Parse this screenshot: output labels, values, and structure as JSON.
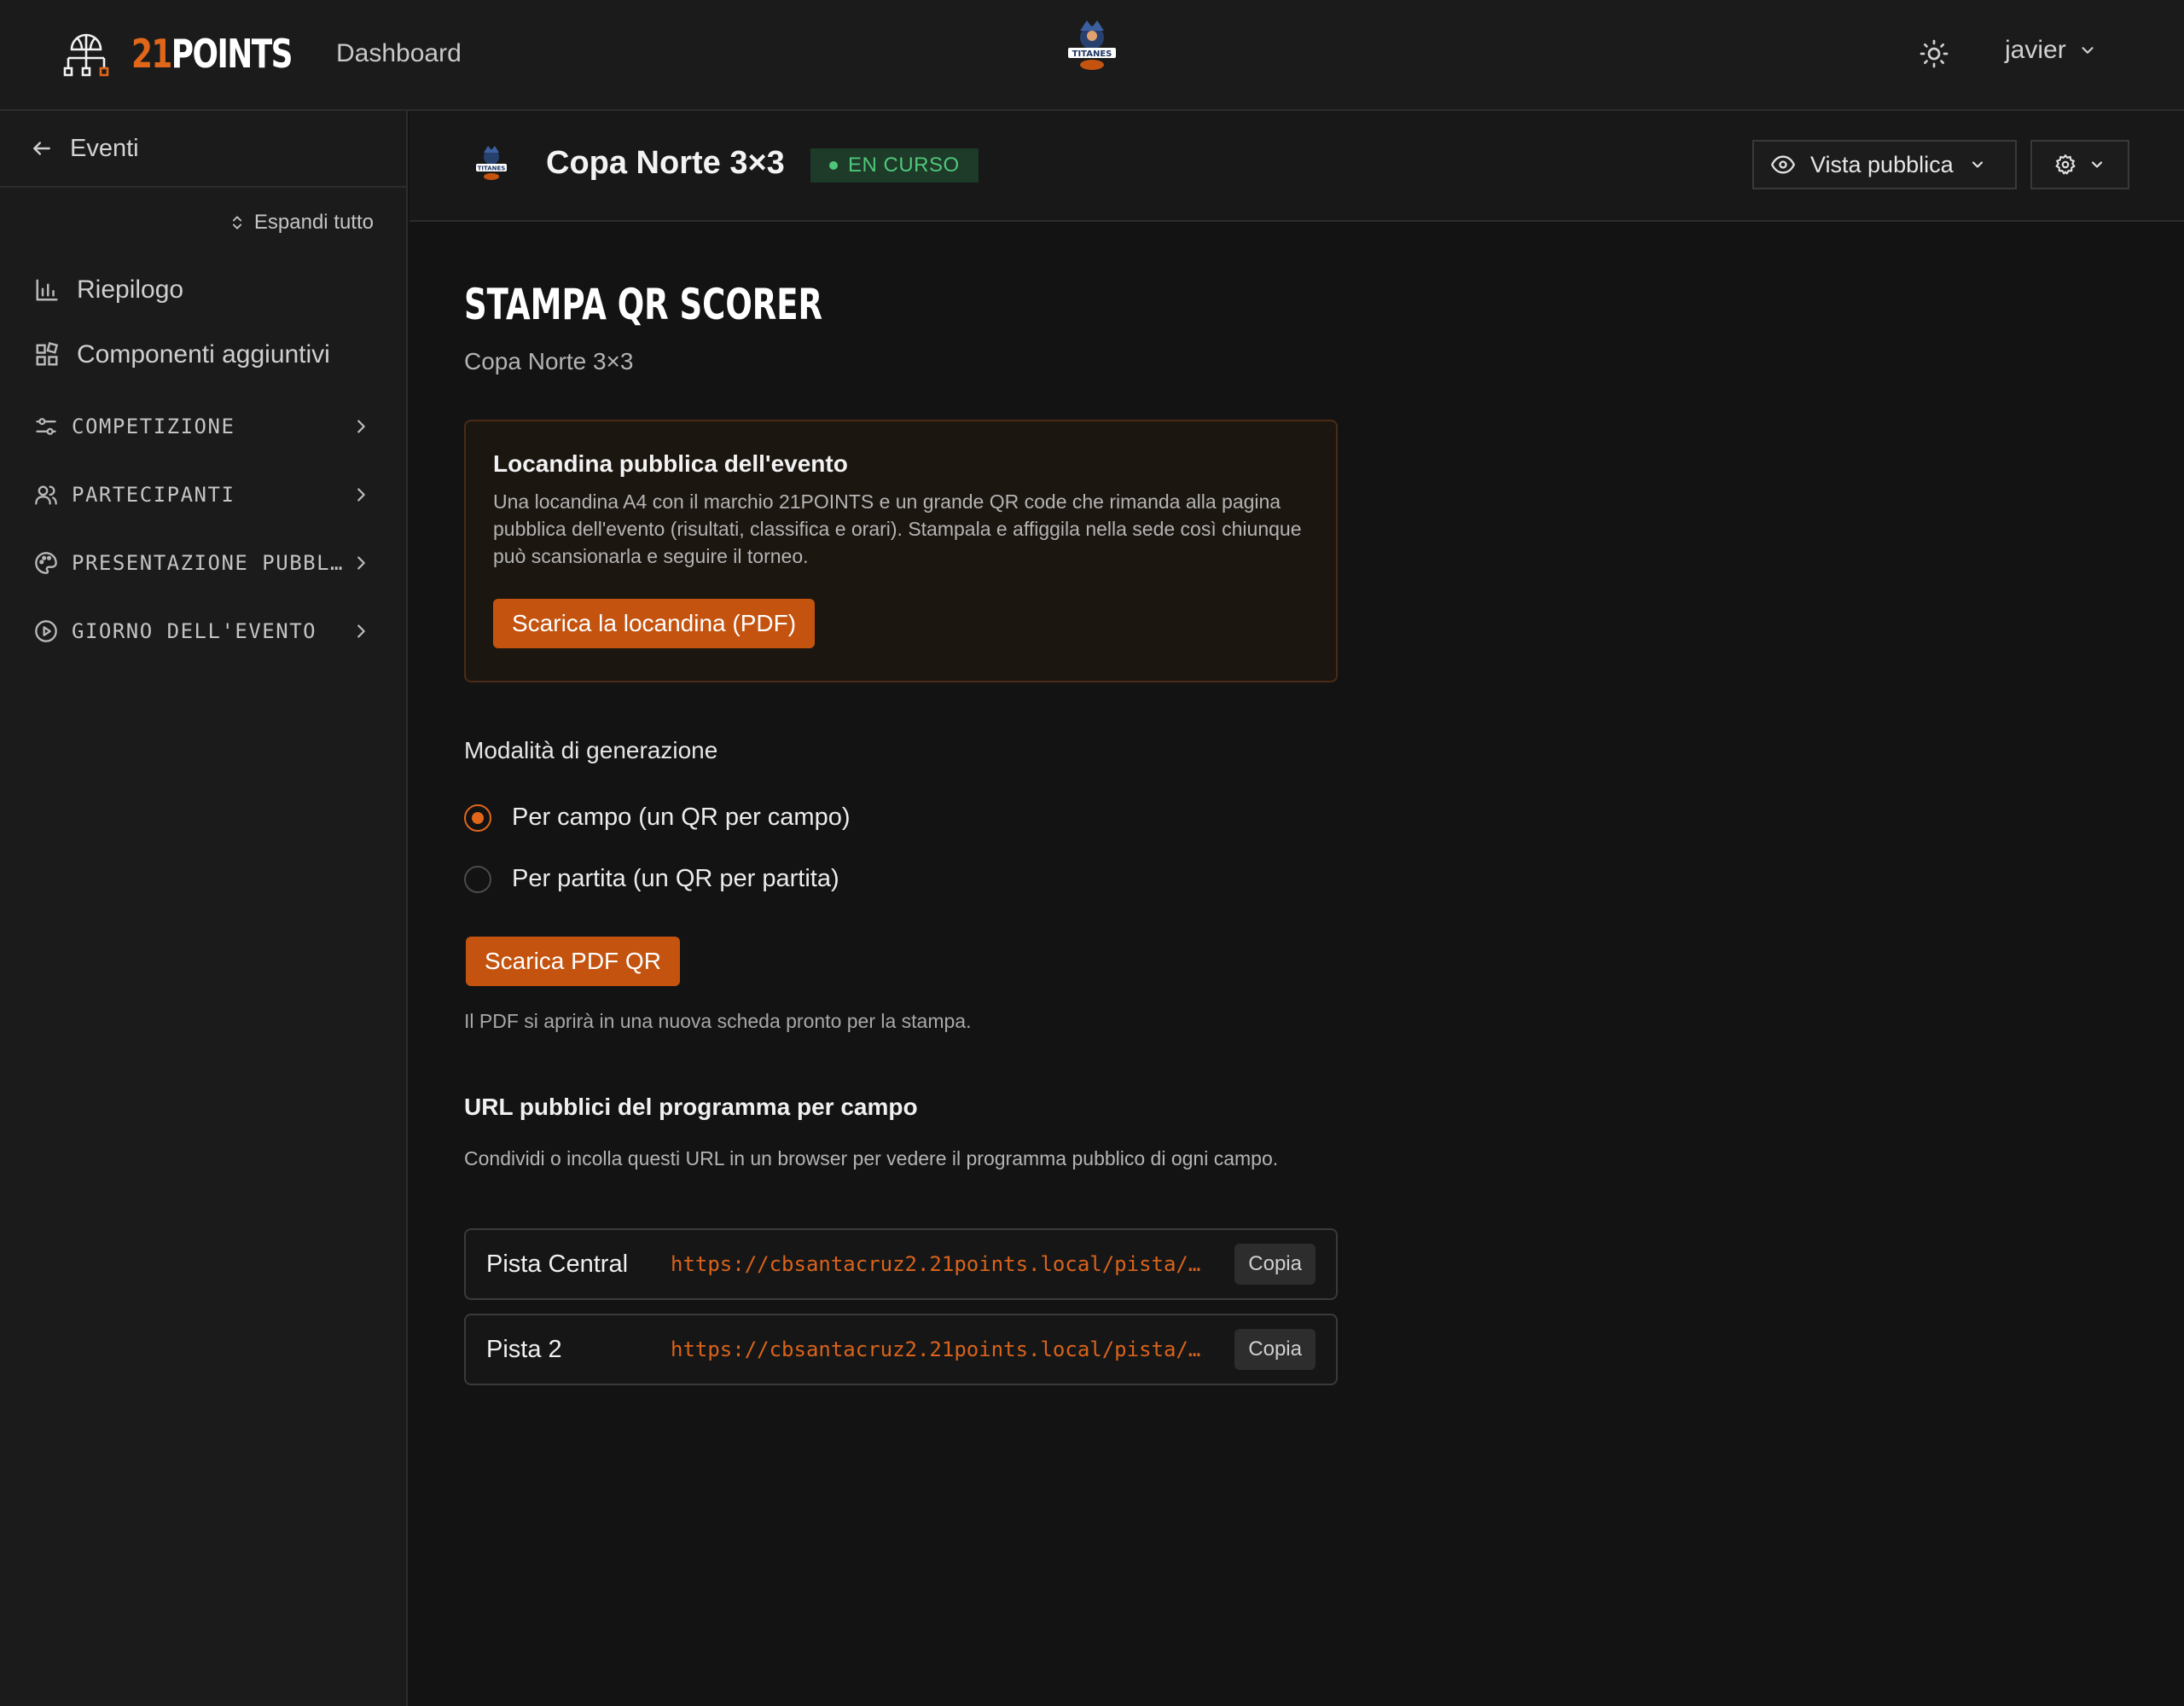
{
  "app": {
    "brand_number": "21",
    "brand_word": "POINTS",
    "nav_dashboard": "Dashboard",
    "username": "javier"
  },
  "sidebar": {
    "back_label": "Eventi",
    "expand_all": "Espandi tutto",
    "items": [
      {
        "label": "Riepilogo",
        "icon": "bar-chart-icon"
      },
      {
        "label": "Componenti aggiuntivi",
        "icon": "widgets-icon"
      }
    ],
    "sections": [
      {
        "label": "COMPETIZIONE",
        "icon": "sliders-icon"
      },
      {
        "label": "PARTECIPANTI",
        "icon": "users-icon"
      },
      {
        "label": "PRESENTAZIONE PUBBL…",
        "icon": "palette-icon"
      },
      {
        "label": "GIORNO DELL'EVENTO",
        "icon": "play-circle-icon"
      }
    ]
  },
  "event": {
    "name": "Copa Norte 3×3",
    "status": "EN CURSO",
    "public_view_label": "Vista pubblica"
  },
  "page": {
    "title": "STAMPA QR SCORER",
    "subtitle": "Copa Norte 3×3",
    "poster": {
      "title": "Locandina pubblica dell'evento",
      "description": "Una locandina A4 con il marchio 21POINTS e un grande QR code che rimanda alla pagina pubblica dell'evento (risultati, classifica e orari). Stampala e affiggila nella sede così chiunque può scansionarla e seguire il torneo.",
      "button": "Scarica la locandina (PDF)"
    },
    "generation": {
      "title": "Modalità di generazione",
      "options": [
        {
          "label": "Per campo (un QR per campo)",
          "selected": true
        },
        {
          "label": "Per partita (un QR per partita)",
          "selected": false
        }
      ],
      "download_button": "Scarica PDF QR",
      "note": "Il PDF si aprirà in una nuova scheda pronto per la stampa."
    },
    "urls": {
      "title": "URL pubblici del programma per campo",
      "description": "Condividi o incolla questi URL in un browser per vedere il programma pubblico di ogni campo.",
      "rows": [
        {
          "name": "Pista Central",
          "url": "https://cbsantacruz2.21points.local/pista/…",
          "copy": "Copia"
        },
        {
          "name": "Pista 2",
          "url": "https://cbsantacruz2.21points.local/pista/…",
          "copy": "Copia"
        }
      ]
    }
  },
  "colors": {
    "accent": "#e0661a",
    "button": "#c4530f",
    "status_green": "#4ec77a",
    "background": "#131313",
    "surface": "#1b1b1b"
  }
}
